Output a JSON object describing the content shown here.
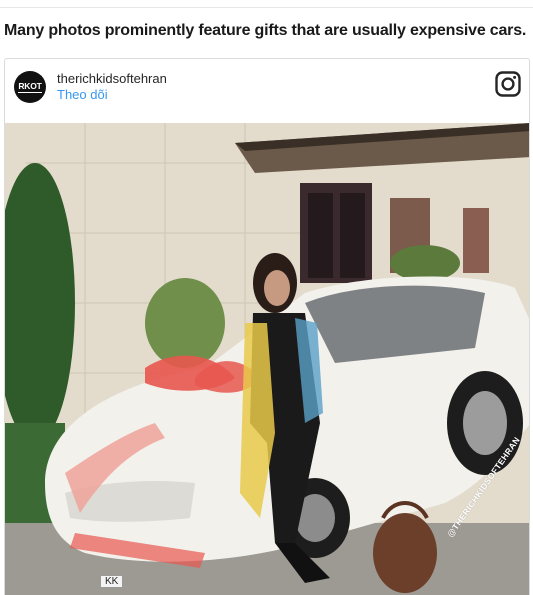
{
  "article": {
    "caption": "Many photos prominently feature gifts that are usually expensive cars."
  },
  "embed": {
    "username": "therichkidsoftehran",
    "follow_label": "Theo dõi",
    "avatar_text": "RKOT",
    "logo_icon": "instagram-icon"
  },
  "photo": {
    "watermark": "@THERICHKIDSOFTEHRAN",
    "plate_text": "KK",
    "description_icon": "photo-woman-white-car-red-bow"
  },
  "colors": {
    "link": "#3897f0",
    "caption": "#1a1a1a",
    "car": "#f2f1ec",
    "bow": "#e8574f"
  }
}
